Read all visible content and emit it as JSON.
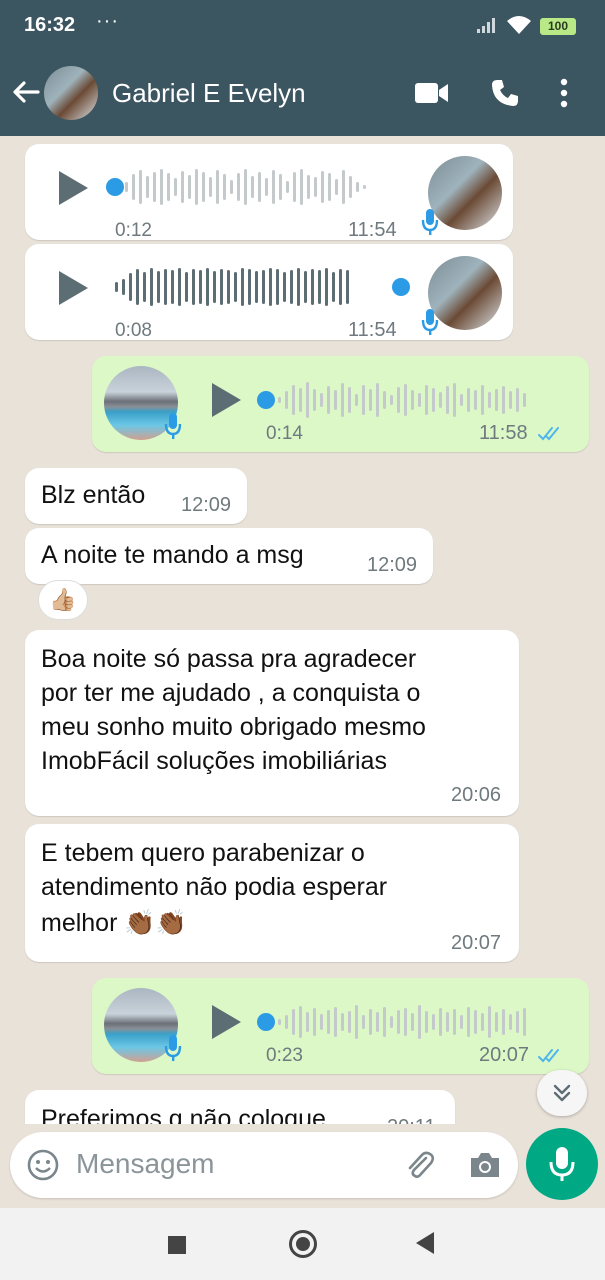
{
  "status_bar": {
    "time": "16:32",
    "dots": "···",
    "battery": "100"
  },
  "header": {
    "contact_name": "Gabriel E Evelyn"
  },
  "messages": [
    {
      "kind": "voice",
      "direction": "in",
      "duration": "0:12",
      "time": "11:54",
      "progress": 0.0
    },
    {
      "kind": "voice",
      "direction": "in",
      "duration": "0:08",
      "time": "11:54",
      "progress": 1.0
    },
    {
      "kind": "voice",
      "direction": "out",
      "duration": "0:14",
      "time": "11:58",
      "status": "read"
    },
    {
      "kind": "text",
      "direction": "in",
      "text": "Blz então",
      "time": "12:09"
    },
    {
      "kind": "text",
      "direction": "in",
      "text": "A noite te mando a msg",
      "time": "12:09",
      "reaction": "👍🏼"
    },
    {
      "kind": "text",
      "direction": "in",
      "lines": [
        "Boa noite só passa pra agradecer",
        "por ter me ajudado , a conquista o",
        "meu sonho muito obrigado mesmo",
        "ImobFácil soluções imobiliárias"
      ],
      "time": "20:06"
    },
    {
      "kind": "text",
      "direction": "in",
      "lines": [
        "E tebem quero parabenizar o",
        "atendimento não podia esperar",
        "melhor 👏🏾👏🏾"
      ],
      "time": "20:07"
    },
    {
      "kind": "voice",
      "direction": "out",
      "duration": "0:23",
      "time": "20:07",
      "status": "read"
    },
    {
      "kind": "text",
      "direction": "in",
      "text": "Preferimos q não coloque",
      "time": "20:11"
    }
  ],
  "input": {
    "placeholder": "Mensagem"
  },
  "colors": {
    "header": "#3b5561",
    "chat_bg": "#e9e2d9",
    "outgoing": "#dcf8c6",
    "accent": "#00a884",
    "voice_dot": "#2c9be5",
    "read_ticks": "#4fb6ec"
  },
  "icons": [
    "back-arrow-icon",
    "video-call-icon",
    "phone-icon",
    "more-vert-icon",
    "play-icon",
    "mic-icon",
    "double-check-icon",
    "emoji-icon",
    "attach-icon",
    "camera-icon",
    "chevron-down-double-icon"
  ]
}
